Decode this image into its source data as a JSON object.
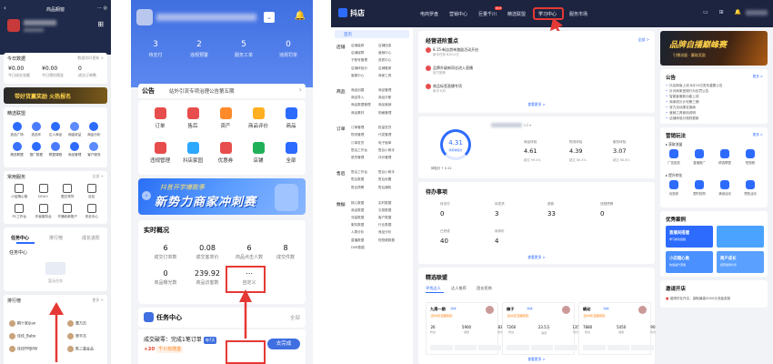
{
  "p1": {
    "title": "商品橱窗",
    "tools": "⋯ ◎",
    "today_hd": "今日数据",
    "today_more": "数据实时更新 >",
    "stats": [
      {
        "value": "¥0.00",
        "label": "今日成交金额"
      },
      {
        "value": "¥0.00",
        "label": "今日预估佣金"
      },
      {
        "value": "0",
        "label": "成交订单数"
      }
    ],
    "banner": "带好货赢奖励  火热报名",
    "svc_hd": "精选联盟",
    "svc": [
      "选品广场",
      "选品车",
      "达人商品",
      "佣金收益",
      "商品分析",
      "精选联盟",
      "推广数据",
      "联盟课程",
      "商品管理",
      "客户服务"
    ],
    "common_hd": "常用服务",
    "common_more": "全部 >",
    "common": [
      "小店随心推",
      "DOU+",
      "图文带货",
      "百应",
      "PC工作台",
      "作者服务台",
      "开通收款账户",
      "安全中心"
    ],
    "tab_task": "任务中心",
    "tab_rank": "排行榜",
    "tab_grow": "成长进阶",
    "task_hd": "任务中心",
    "task_empty": "暂无任务",
    "rank_hd": "排行榜",
    "rank_more": "更多 >",
    "ranks": [
      {
        "name": "桐十家ijian",
        "right": "惠万吉"
      },
      {
        "name": "佳佳_Babe",
        "right": "翠丰吉"
      },
      {
        "name": "佳佳FMJIAN",
        "right": "陈三喜金品"
      }
    ]
  },
  "p2": {
    "bell": "🔔",
    "stats": [
      {
        "value": "3",
        "label": "待支付"
      },
      {
        "value": "2",
        "label": "违规预警"
      },
      {
        "value": "5",
        "label": "服务工单"
      },
      {
        "value": "0",
        "label": "违规罚单"
      }
    ],
    "notice_title": "公告",
    "notice_msg": "站外引流专项治理公告第五期",
    "grid": [
      {
        "label": "订单",
        "color": "#e84d4d"
      },
      {
        "label": "售后",
        "color": "#e84d4d"
      },
      {
        "label": "资产",
        "color": "#ff8a2a"
      },
      {
        "label": "商品评价",
        "color": "#ffb020"
      },
      {
        "label": "商品",
        "color": "#2d6bff"
      },
      {
        "label": "违规管理",
        "color": "#e84d4d"
      },
      {
        "label": "抖店家园",
        "color": "#2da8ff"
      },
      {
        "label": "优惠券",
        "color": "#e84d4d"
      },
      {
        "label": "店铺",
        "color": "#20b05a"
      },
      {
        "label": "全部",
        "color": "#2d6bff"
      }
    ],
    "banner_small": "抖音开学爆款季",
    "banner_big": "新势力商家冲刺赛",
    "rt_hd": "实时概况",
    "rt": [
      {
        "value": "6",
        "label": "成交订单数"
      },
      {
        "value": "0.08",
        "label": "成交客单价"
      },
      {
        "value": "6",
        "label": "商品点击人数"
      },
      {
        "value": "8",
        "label": "成交件数"
      },
      {
        "value": "0",
        "label": "商品曝光数"
      },
      {
        "value": "239.92",
        "label": "商品访客数"
      },
      {
        "value": "⋯",
        "label": "自定义"
      }
    ],
    "task_hd": "任务中心",
    "task_all": "全部",
    "task_title": "成交破零：完成1笔订单",
    "task_badge": "每7天",
    "task_reward": "+20",
    "task_reward_tag": "千川有赠金",
    "task_btn": "去完成"
  },
  "p3": {
    "logo": "抖店",
    "nav": [
      "电商罗盘",
      "营销中心",
      "巨量千川",
      "精选联盟",
      "学习中心",
      "服务市场"
    ],
    "nav_hot": "HOT",
    "nav_icons": "▭ ⊞ 🔔",
    "home": "首页",
    "groups": [
      {
        "name": "店铺",
        "items": [
          "店铺装修",
          "店铺信息",
          "店铺保障",
          "营销中心",
          "子账号管理",
          "资质中心",
          "店铺体验分",
          "店铺管家",
          "客服中心",
          "商家工具"
        ]
      },
      {
        "name": "商品",
        "items": [
          "商品创建",
          "商品管理",
          "商品导入",
          "商品诊断",
          "商品数据管理",
          "商品营销",
          "商品素材",
          "规格管理"
        ]
      },
      {
        "name": "订单",
        "items": [
          "订单管理",
          "批量发货",
          "物流管理",
          "代发管理",
          "订单发货",
          "电子面单",
          "售后工作台",
          "售后小助手",
          "退货管理",
          "评价管理"
        ]
      },
      {
        "name": "售后",
        "items": [
          "售后工作台",
          "售后小助手",
          "售后数据",
          "售后设置",
          "售后预警",
          "售后通知"
        ]
      },
      {
        "name": "数据",
        "items": [
          "核心数据",
          "实时数据",
          "商品数据",
          "交易数据",
          "流量数据",
          "客户数据",
          "服务数据",
          "行业数据",
          "人群分析",
          "竞品分析",
          "直播数据",
          "短视频数据",
          "DSR数据"
        ]
      }
    ],
    "news_hd": "经营进阶重点",
    "news_more": "全部 >",
    "news": [
      {
        "t": "8.15·新店首单激励活动开启",
        "s": "新手任务·8月12日"
      },
      {
        "t": "品牌升级新同志进入直播",
        "s": "官方推荐"
      },
      {
        "t": "商品标签直播专项",
        "s": "新手·8月"
      }
    ],
    "news_link": "查看更多 >",
    "exp_score": "4.31",
    "exp_score_lbl": "商家体验分",
    "exp_note": "体验分 ↑ 0.21",
    "exp_title": "v3 ▾",
    "exp": [
      {
        "l": "商品体验",
        "v": "4.61",
        "s": "超过 99.4%"
      },
      {
        "l": "物流体验",
        "v": "4.39",
        "s": "超过 88.4%"
      },
      {
        "l": "服务体验",
        "v": "3.07",
        "s": "超过 68.8%"
      }
    ],
    "todo_hd": "待办事项",
    "todo": [
      {
        "l": "待支付",
        "v": "0"
      },
      {
        "l": "待发货",
        "v": "3"
      },
      {
        "l": "退款",
        "v": "33"
      },
      {
        "l": "违规预警",
        "v": "0"
      },
      {
        "l": "已完成",
        "v": "40"
      },
      {
        "l": "待评价",
        "v": "4"
      }
    ],
    "todo_link": "查看更多 >",
    "lm_hd": "精选联盟",
    "lm_tabs": [
      "寻找达人",
      "达人推荐",
      "团长招商"
    ],
    "lm_cards": [
      {
        "name": "九周一期",
        "tag": "LV3",
        "goods": "近30天 直播带货",
        "nums": [
          [
            "26",
            "粉丝"
          ],
          [
            "5900",
            "销量"
          ],
          [
            "83",
            "场次"
          ]
        ]
      },
      {
        "name": "楠子",
        "tag": "LV4",
        "goods": "近30天 直播带货",
        "nums": [
          [
            "7260",
            "粉丝"
          ],
          [
            "23.5万",
            "销量"
          ],
          [
            "135",
            "场次"
          ]
        ]
      },
      {
        "name": "蜗幼",
        "tag": "LV2",
        "goods": "近30天 直播带货",
        "nums": [
          [
            "7880",
            "粉丝"
          ],
          [
            "5450",
            "销量"
          ],
          [
            "90",
            "场次"
          ]
        ]
      }
    ],
    "lm_link": "查看更多 >",
    "r_banner": "品牌自播巅峰赛",
    "r_banner_sub": "引爆流量 · 赢取奖励",
    "ann_hd": "公告",
    "ann_more": "更多 >",
    "anns": [
      "抖店新版上线·8月15日发布重要公告",
      "针对商家违规行为处罚公告",
      "智能客服新功能上线",
      "商家成长计划第三期",
      "官方活动报名指南",
      "营销工具使用说明",
      "店铺体验分规则更新"
    ],
    "yx_hd": "营销玩法",
    "yx_more": "更多 >",
    "yx_sub1": "▸ 获取流量",
    "yx_tools1": [
      "广告投放",
      "直播推广",
      "精选联盟",
      "短视频"
    ],
    "yx_sub2": "▸ 提升转化",
    "yx_tools2": [
      "优惠券",
      "限时抢购",
      "满减活动",
      "预售活动"
    ],
    "case_hd": "优秀案例",
    "cases": [
      {
        "t": "直播间搭建",
        "s": "学习成功经验",
        "c": "#2d6bff"
      },
      {
        "t": "",
        "s": "",
        "c": "#4aa3ff"
      },
      {
        "t": "小店随心推",
        "s": "快速提升流量",
        "c": "#4a90ff"
      },
      {
        "t": "商户成长",
        "s": "经营案例分享",
        "c": "#5aa0ff"
      }
    ],
    "invite_hd": "邀请开店",
    "invite_msg": "邀请好友开店，赢取最高5000元流量奖励"
  },
  "colors": {
    "accent": "#2d6bff",
    "highlight": "#e53935"
  }
}
